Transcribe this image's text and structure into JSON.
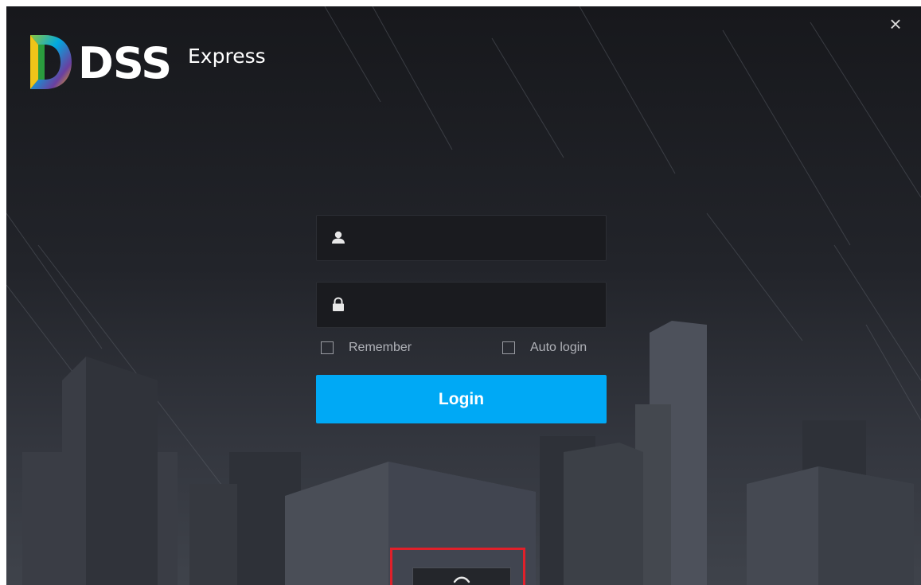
{
  "brand": {
    "name": "DSS",
    "edition": "Express"
  },
  "login": {
    "username_placeholder": "",
    "password_placeholder": "",
    "remember_label": "Remember",
    "auto_login_label": "Auto login",
    "remember_checked": false,
    "auto_login_checked": false,
    "button_label": "Login"
  },
  "window": {
    "close_glyph": "×"
  },
  "icons": {
    "close": "close-icon",
    "user": "user-icon",
    "lock": "lock-icon",
    "expand": "chevron-up-icon"
  },
  "colors": {
    "accent": "#00a9f5",
    "highlight_border": "#e0202a",
    "background_dark": "#1b1c21",
    "field_bg": "#1a1b1f"
  }
}
